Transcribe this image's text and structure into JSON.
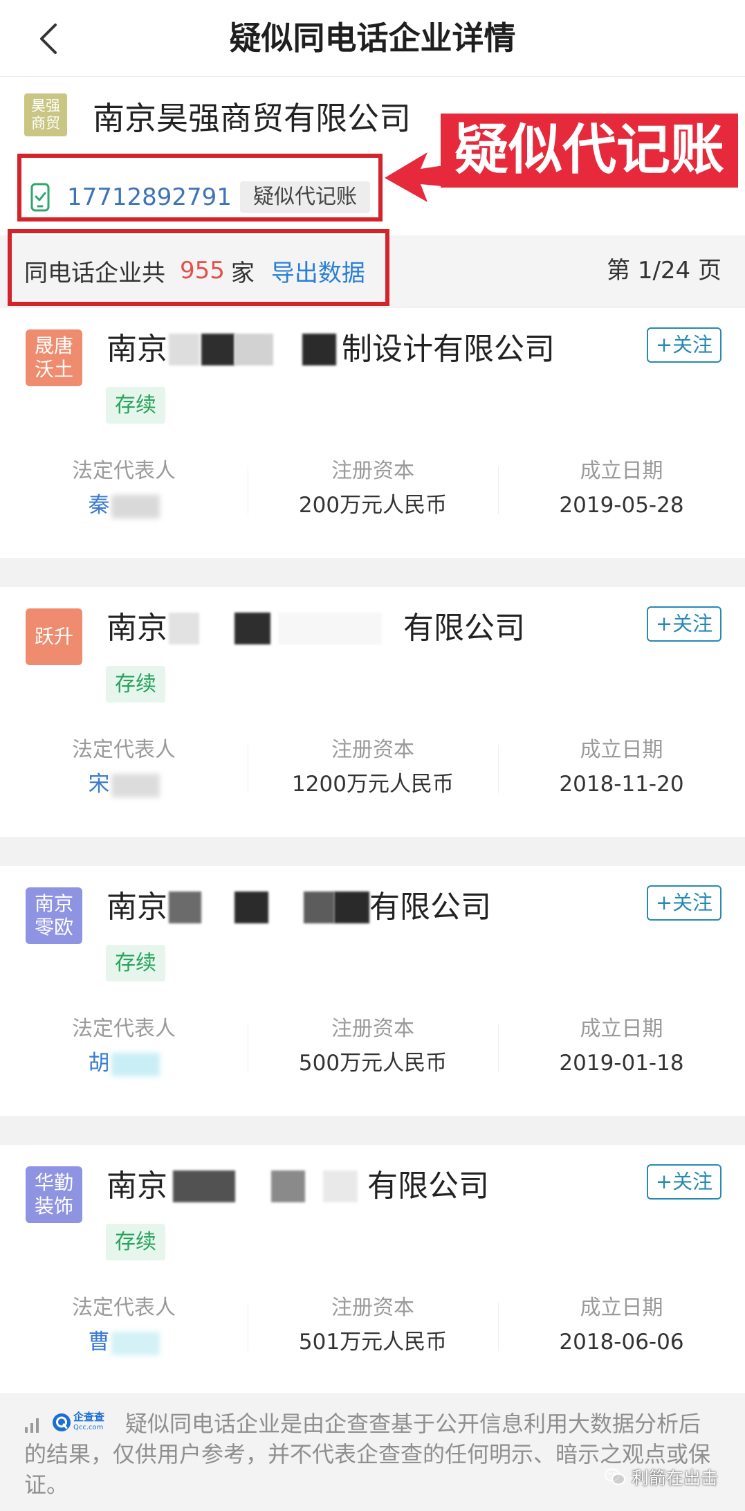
{
  "header": {
    "title": "疑似同电话企业详情"
  },
  "icons": {
    "back": "chevron-left-icon",
    "phone": "phone-check-icon",
    "arrow": "arrow-left-icon",
    "signal": "signal-bars-icon",
    "brand": "qcc-logo-icon",
    "wechat": "wechat-icon"
  },
  "company": {
    "logo_lines": [
      "昊强",
      "商贸"
    ],
    "logo_color": "#c9c583",
    "name": "南京昊强商贸有限公司",
    "phone": "17712892791",
    "phone_tag": "疑似代记账"
  },
  "annotation": {
    "label": "疑似代记账",
    "label_color": "#e62a3b",
    "outline_color": "#d3242b"
  },
  "summary": {
    "prefix": "同电话企业共",
    "count": "955",
    "suffix": "家",
    "export_label": "导出数据",
    "page_label": "第 1/24 页"
  },
  "labels": {
    "follow": "+关注",
    "legal_rep": "法定代表人",
    "capital": "注册资本",
    "date": "成立日期"
  },
  "companies": [
    {
      "logo_lines": [
        "晟唐",
        "沃土"
      ],
      "logo_color": "#ef8b6e",
      "name_prefix": "南京",
      "name_suffix": "制设计有限公司",
      "status": "存续",
      "legal_rep": "秦",
      "capital": "200万元人民币",
      "date": "2019-05-28"
    },
    {
      "logo_lines": [
        "跃升"
      ],
      "logo_color": "#ef8b6e",
      "name_prefix": "南京",
      "name_suffix": "有限公司",
      "status": "存续",
      "legal_rep": "宋",
      "capital": "1200万元人民币",
      "date": "2018-11-20"
    },
    {
      "logo_lines": [
        "南京",
        "零欧"
      ],
      "logo_color": "#8f94e2",
      "name_prefix": "南京",
      "name_suffix": "有限公司",
      "status": "存续",
      "legal_rep": "胡",
      "capital": "500万元人民币",
      "date": "2019-01-18"
    },
    {
      "logo_lines": [
        "华勤",
        "装饰"
      ],
      "logo_color": "#8f94e2",
      "name_prefix": "南京",
      "name_suffix": "有限公司",
      "status": "存续",
      "legal_rep": "曹",
      "capital": "501万元人民币",
      "date": "2018-06-06"
    }
  ],
  "footer": {
    "brand_cn": "企查查",
    "brand_en": "Qcc.com",
    "disclaimer": "疑似同电话企业是由企查查基于公开信息利用大数据分析后的结果，仅供用户参考，并不代表企查查的任何明示、暗示之观点或保证。"
  },
  "watermark": {
    "text": "利箭在出击"
  },
  "colors": {
    "phone_blue": "#3d73b8",
    "count_red": "#e2504c",
    "export_blue": "#2b7fd4",
    "follow_teal": "#2589b2",
    "status_green": "#27a35c",
    "status_bg": "#e7f6ec",
    "legal_rep_blue": "#3b7bd2"
  }
}
